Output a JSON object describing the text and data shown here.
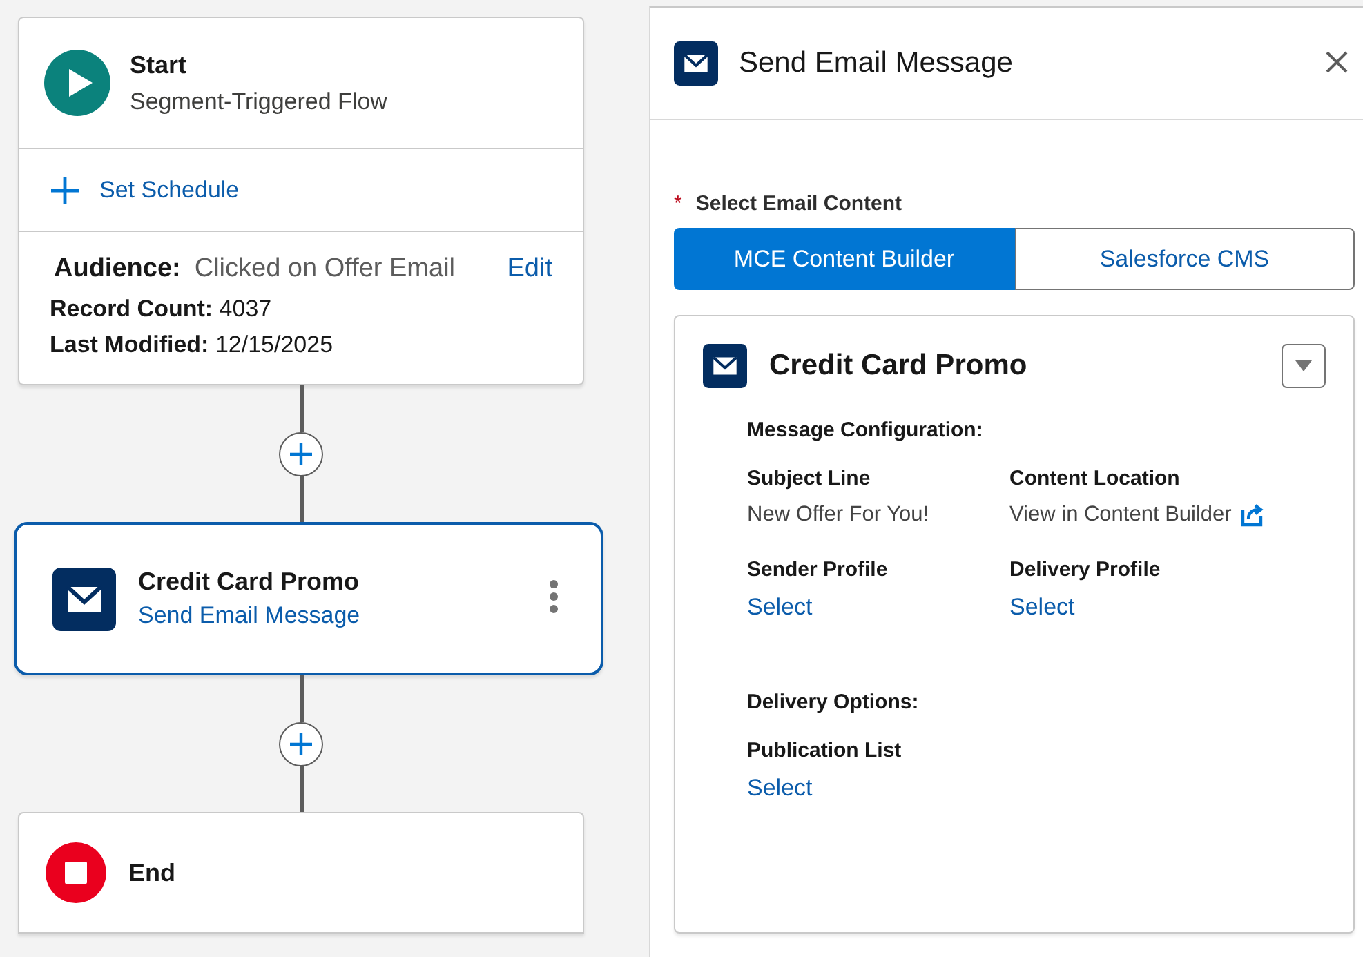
{
  "canvas": {
    "start_node": {
      "title": "Start",
      "subtitle": "Segment-Triggered Flow",
      "schedule_link": "Set Schedule",
      "audience": {
        "label": "Audience:",
        "value": "Clicked on Offer Email",
        "edit_link": "Edit"
      },
      "details": [
        {
          "label": "Record Count:",
          "value": "4037"
        },
        {
          "label": "Last Modified:",
          "value": "12/15/2025"
        }
      ]
    },
    "action_node": {
      "title": "Credit Card Promo",
      "subtitle": "Send Email Message",
      "selected": true
    },
    "end_node": {
      "title": "End"
    }
  },
  "panel": {
    "title": "Send Email Message",
    "content_field": {
      "label": "Select Email Content",
      "required": true,
      "required_marker": "*",
      "options": [
        {
          "label": "MCE Content Builder",
          "selected": true
        },
        {
          "label": "Salesforce CMS",
          "selected": false
        }
      ]
    },
    "content_card": {
      "title": "Credit Card Promo",
      "sections": [
        {
          "heading": "Message Configuration:",
          "fields": [
            {
              "label": "Subject Line",
              "value": "New Offer For You!",
              "kind": "text"
            },
            {
              "label": "Content Location",
              "value": "View in Content Builder",
              "kind": "external"
            },
            {
              "label": "Sender Profile",
              "value": "Select",
              "kind": "link"
            },
            {
              "label": "Delivery Profile",
              "value": "Select",
              "kind": "link"
            }
          ]
        },
        {
          "heading": "Delivery Options:",
          "fields": [
            {
              "label": "Publication List",
              "value": "Select",
              "kind": "link"
            }
          ]
        }
      ]
    }
  }
}
